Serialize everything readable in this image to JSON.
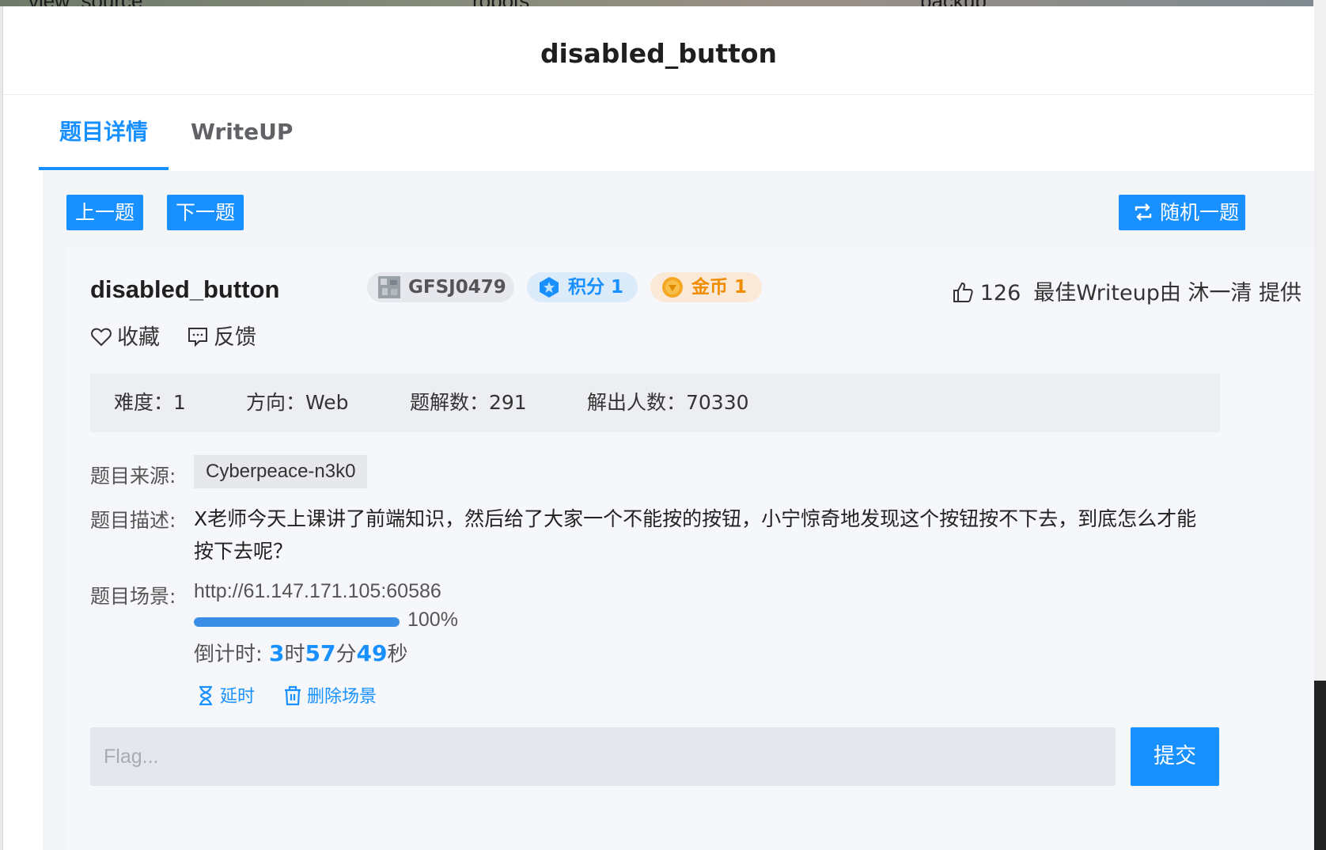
{
  "background": {
    "tabs": [
      "view_source",
      "robots",
      "backup"
    ]
  },
  "modal": {
    "title": "disabled_button"
  },
  "tabs": {
    "detail": "题目详情",
    "writeup": "WriteUP"
  },
  "nav": {
    "prev": "上一题",
    "next": "下一题",
    "random": "随机一题"
  },
  "problem": {
    "title": "disabled_button",
    "id": "GFSJ0479",
    "score": "积分 1",
    "coin": "金币 1",
    "likes": "126",
    "best_writeup": "最佳Writeup由 沐一清 提供",
    "favorite": "收藏",
    "feedback": "反馈"
  },
  "stats": {
    "difficulty": "难度：1",
    "direction": "方向：Web",
    "writeups": "题解数：291",
    "solvers": "解出人数：70330"
  },
  "fields": {
    "source_label": "题目来源:",
    "source": "Cyberpeace-n3k0",
    "desc_label": "题目描述:",
    "desc": "X老师今天上课讲了前端知识，然后给了大家一个不能按的按钮，小宁惊奇地发现这个按钮按不下去，到底怎么才能按下去呢？",
    "scene_label": "题目场景:",
    "scene_url": "http://61.147.171.105:60586",
    "progress_percent": 100,
    "progress_text": "100%",
    "countdown": {
      "prefix": "倒计时: ",
      "hours": "3",
      "h_unit": "时",
      "minutes": "57",
      "m_unit": "分",
      "seconds": "49",
      "s_unit": "秒"
    },
    "extend": "延时",
    "delete_scene": "删除场景"
  },
  "flag": {
    "placeholder": "Flag...",
    "value": "",
    "submit": "提交"
  },
  "colors": {
    "primary": "#1890ff",
    "coin": "#f08c00"
  }
}
